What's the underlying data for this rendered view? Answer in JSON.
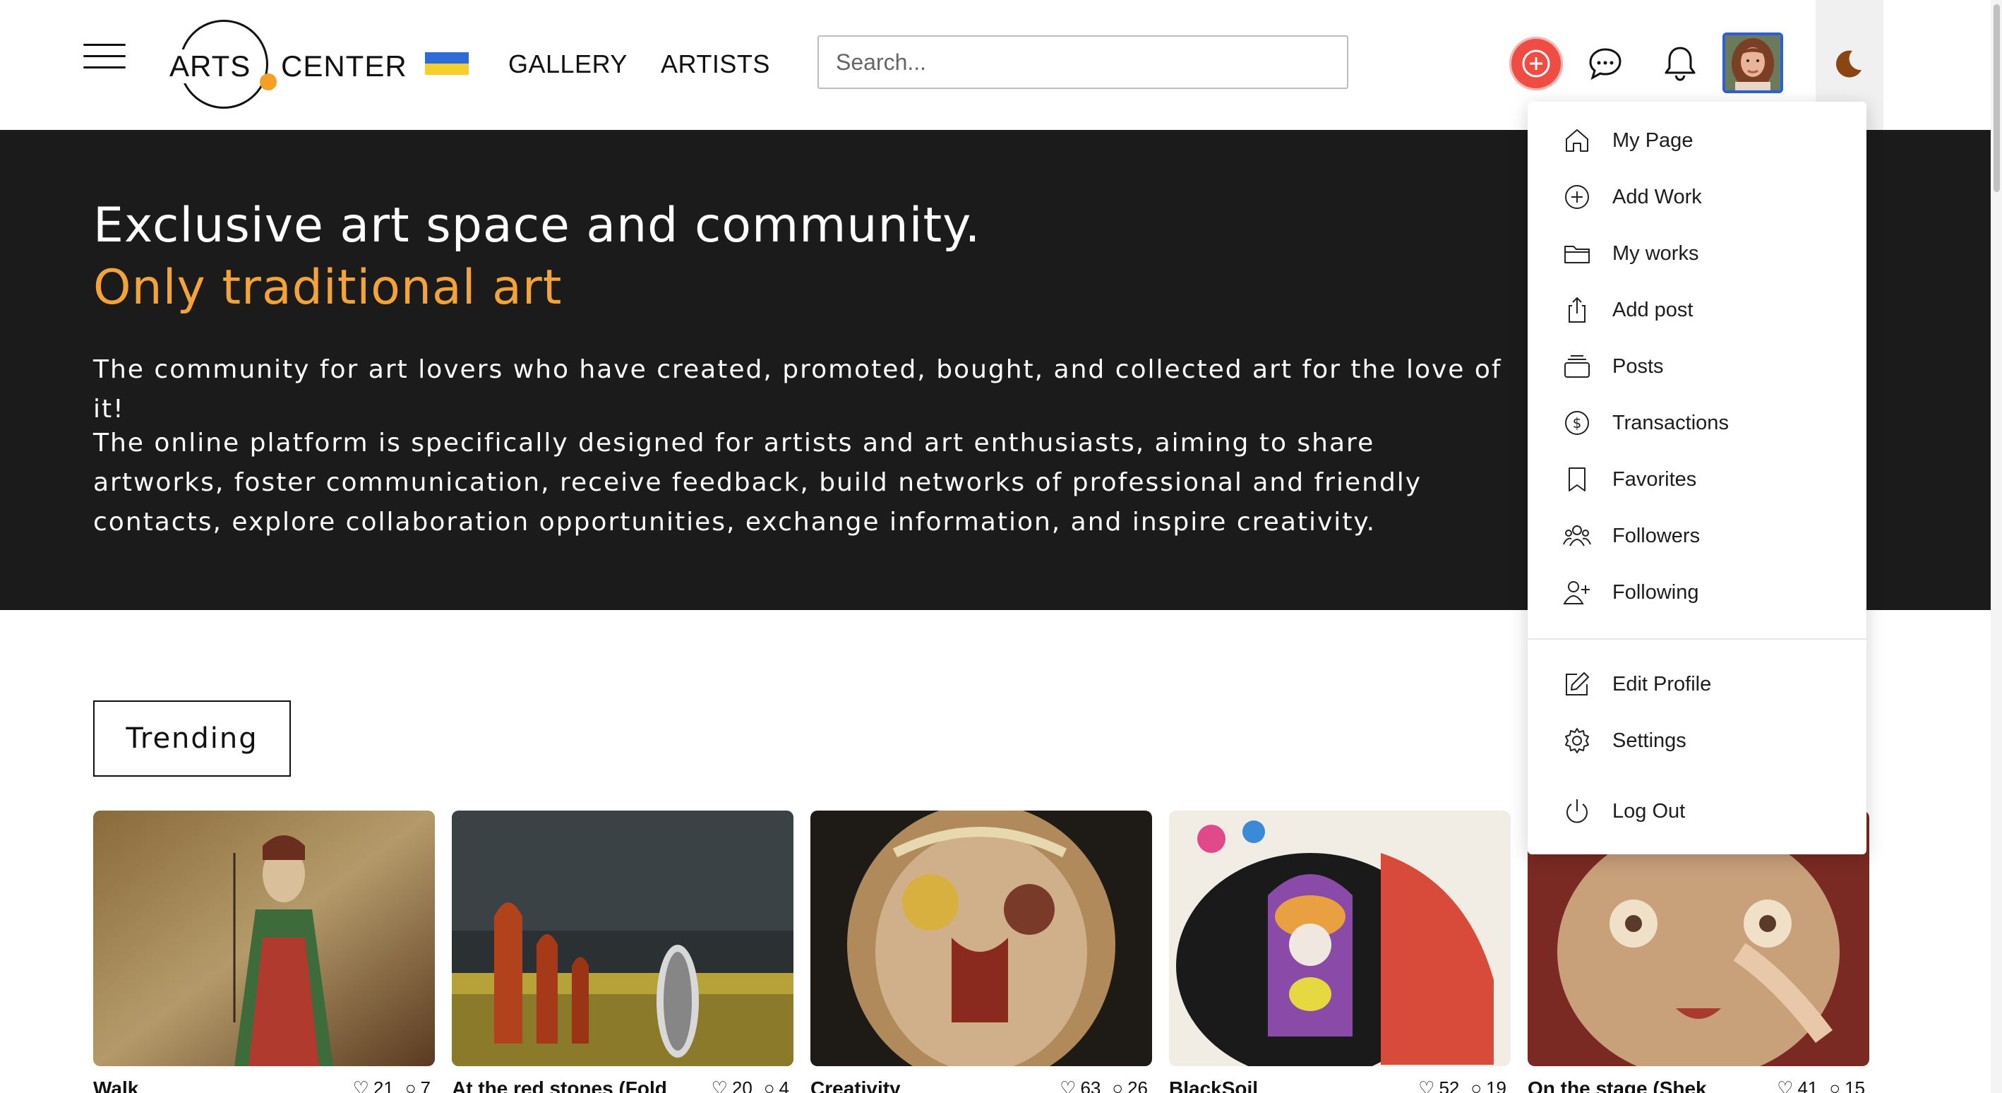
{
  "header": {
    "logo_left": "ARTS",
    "logo_right": "CENTER",
    "nav": [
      "GALLERY",
      "ARTISTS"
    ],
    "search_placeholder": "Search..."
  },
  "hero": {
    "title": "Exclusive art space and community.",
    "subtitle": "Only traditional art",
    "paragraph1": "The community for art lovers who have created, promoted, bought, and collected art for the love of it!",
    "paragraph2": "The online platform is specifically designed for artists and art enthusiasts, aiming to share artworks, foster communication, receive feedback, build networks of professional and friendly contacts, explore collaboration opportunities, exchange information, and inspire creativity."
  },
  "trending_label": "Trending",
  "cards": [
    {
      "title": "Walk",
      "likes": "21",
      "comments": "7"
    },
    {
      "title": "At the red stones (Fold",
      "likes": "20",
      "comments": "4"
    },
    {
      "title": "Creativity",
      "likes": "63",
      "comments": "26"
    },
    {
      "title": "BlackSoil",
      "likes": "52",
      "comments": "19"
    },
    {
      "title": "On the stage (Shek",
      "likes": "41",
      "comments": "15"
    }
  ],
  "menu": {
    "items": [
      {
        "label": "My Page",
        "icon": "home-icon"
      },
      {
        "label": "Add Work",
        "icon": "plus-circle-icon"
      },
      {
        "label": "My works",
        "icon": "folder-icon"
      },
      {
        "label": "Add post",
        "icon": "upload-icon"
      },
      {
        "label": "Posts",
        "icon": "stack-icon"
      },
      {
        "label": "Transactions",
        "icon": "dollar-icon"
      },
      {
        "label": "Favorites",
        "icon": "bookmark-icon"
      },
      {
        "label": "Followers",
        "icon": "people-icon"
      },
      {
        "label": "Following",
        "icon": "person-plus-icon"
      }
    ],
    "bottom_items": [
      {
        "label": "Edit Profile",
        "icon": "edit-icon"
      },
      {
        "label": "Settings",
        "icon": "gear-icon"
      },
      {
        "label": "Log Out",
        "icon": "power-icon"
      }
    ]
  },
  "colors": {
    "accent": "#f3a338",
    "hero_bg": "#1b1b1c",
    "add_button": "#ef4d44",
    "avatar_border": "#2c5fd8",
    "theme_icon": "#8b4513"
  }
}
